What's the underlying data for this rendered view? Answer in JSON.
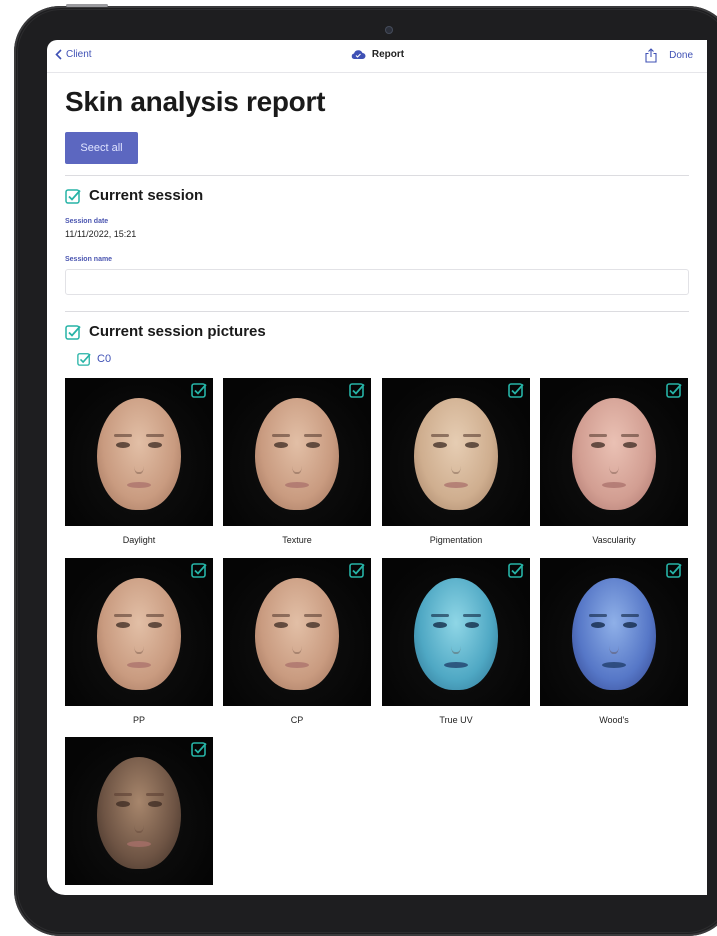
{
  "nav": {
    "back_label": "Client",
    "title": "Report",
    "done_label": "Done"
  },
  "page": {
    "title": "Skin analysis report",
    "select_all_label": "Seect all"
  },
  "current_session": {
    "title": "Current session",
    "date_label": "Session date",
    "date_value": "11/11/2022, 15:21",
    "name_label": "Session name",
    "name_value": ""
  },
  "pictures": {
    "title": "Current session pictures",
    "group_label": "C0",
    "items": [
      {
        "caption": "Daylight",
        "tone": "daylight"
      },
      {
        "caption": "Texture",
        "tone": "daylight"
      },
      {
        "caption": "Pigmentation",
        "tone": "pigment"
      },
      {
        "caption": "Vascularity",
        "tone": "vascular"
      },
      {
        "caption": "PP",
        "tone": "daylight"
      },
      {
        "caption": "CP",
        "tone": "daylight"
      },
      {
        "caption": "True UV",
        "tone": "uv"
      },
      {
        "caption": "Wood's",
        "tone": "woods"
      },
      {
        "caption": "",
        "tone": "dark"
      }
    ]
  },
  "colors": {
    "accent": "#3f51b5",
    "button": "#5c67c0",
    "check": "#26b3a6"
  }
}
